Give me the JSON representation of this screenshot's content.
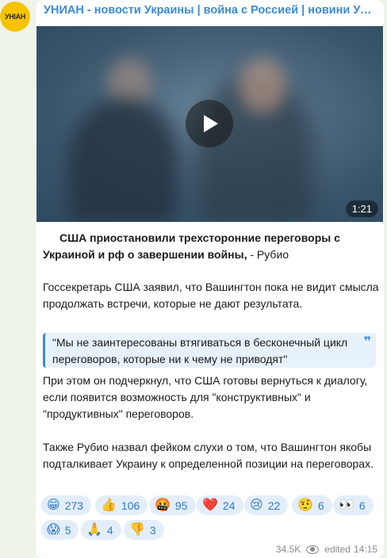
{
  "channel": {
    "avatar_text": "УНІАН",
    "title": "УНИАН - новости Украины | война с Россией | новини України | УНІАН"
  },
  "video": {
    "duration": "1:21"
  },
  "post": {
    "headline_bold": "США приостановили трехсторонние переговоры с Украиной и рф о завершении войны,",
    "headline_rest": " - Рубио",
    "para1": "Госсекретарь США заявил, что Вашингтон пока не видит смысла продолжать встречи, которые не дают результата.",
    "quote": "\"Мы не заинтересованы втягиваться в бесконечный цикл переговоров, которые ни к чему не приводят\"",
    "para2": "При этом он подчеркнул, что США готовы вернуться к диалогу, если появится возможность для \"конструктивных\" и \"продуктивных\" переговоров.",
    "para3": "Также Рубио назвал фейком слухи о том, что Вашингтон якобы подталкивает Украину к определенной позиции на переговорах."
  },
  "reactions": [
    {
      "emoji": "😁",
      "count": "273"
    },
    {
      "emoji": "👍",
      "count": "106"
    },
    {
      "emoji": "🤬",
      "count": "95"
    },
    {
      "emoji": "❤️",
      "count": "24"
    },
    {
      "emoji": "😢",
      "count": "22"
    },
    {
      "emoji": "🤨",
      "count": "6"
    },
    {
      "emoji": "👀",
      "count": "6"
    },
    {
      "emoji": "😱",
      "count": "5"
    },
    {
      "emoji": "🙏",
      "count": "4"
    },
    {
      "emoji": "👎",
      "count": "3"
    }
  ],
  "meta": {
    "views": "34.5K",
    "edited_label": "edited",
    "time": "14:15"
  }
}
